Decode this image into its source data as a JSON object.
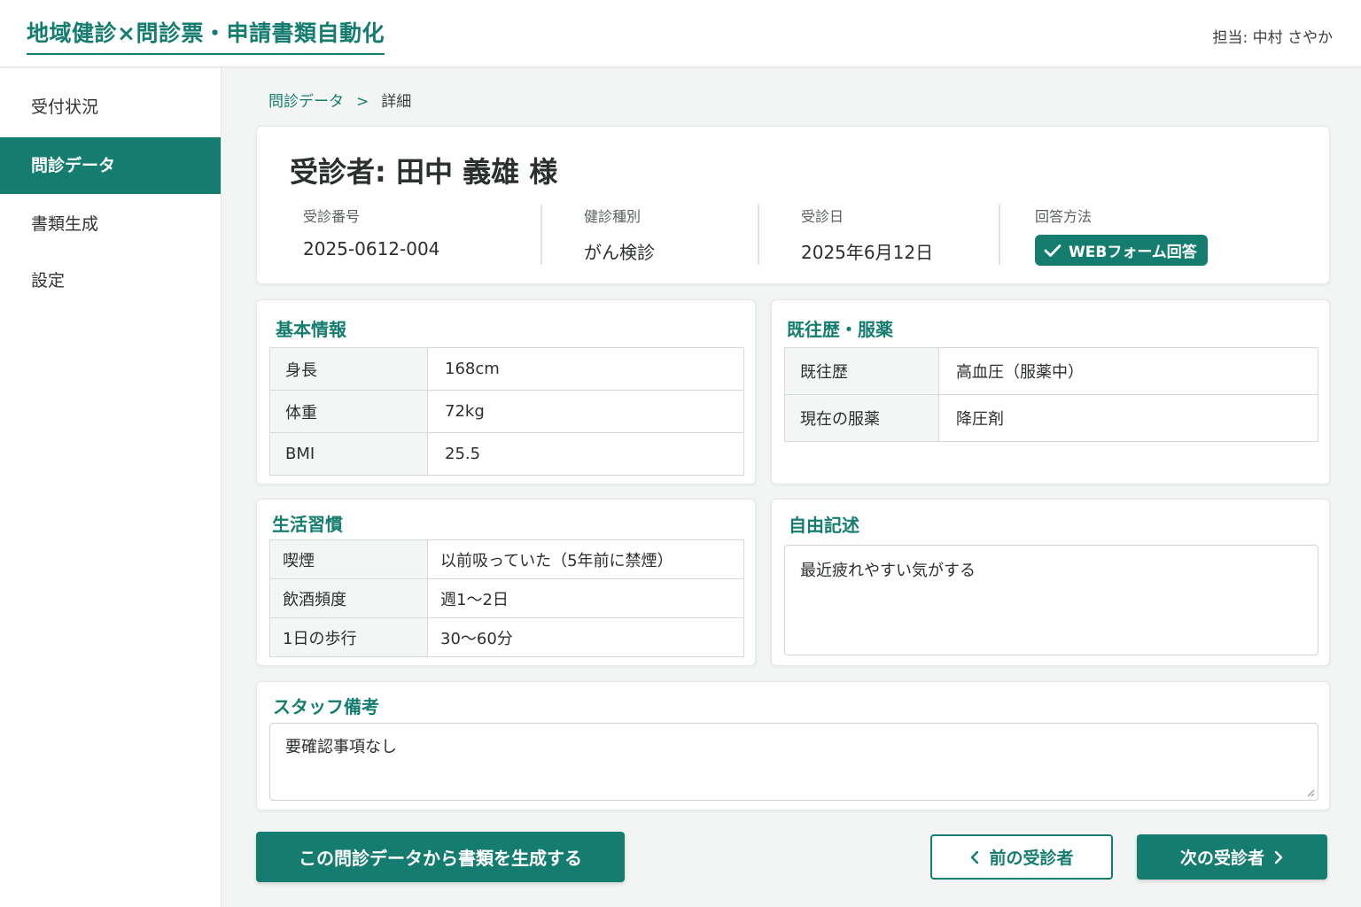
{
  "header": {
    "app_title": "地域健診×問診票・申請書類自動化",
    "user_label": "担当: 中村 さやか"
  },
  "sidebar": {
    "items": [
      {
        "label": "受付状況"
      },
      {
        "label": "問診データ",
        "active": true
      },
      {
        "label": "書類生成"
      },
      {
        "label": "設定"
      }
    ]
  },
  "breadcrumb": {
    "parent": "問診データ",
    "separator": ">",
    "current": "詳細"
  },
  "patient": {
    "title": "受診者: 田中 義雄 様",
    "exam_number_label": "受診番号",
    "exam_number": "2025-0612-004",
    "exam_type_label": "健診種別",
    "exam_type": "がん検診",
    "exam_date_label": "受診日",
    "exam_date": "2025年6月12日",
    "answer_method_label": "回答方法",
    "answer_method": "WEBフォーム回答"
  },
  "basic_info": {
    "title": "基本情報",
    "rows": [
      {
        "key": "身長",
        "value": "168cm"
      },
      {
        "key": "体重",
        "value": "72kg"
      },
      {
        "key": "BMI",
        "value": "25.5"
      }
    ]
  },
  "history": {
    "title": "既往歴・服薬",
    "rows": [
      {
        "key": "既往歴",
        "value": "高血圧（服薬中）"
      },
      {
        "key": "現在の服薬",
        "value": "降圧剤"
      }
    ]
  },
  "lifestyle": {
    "title": "生活習慣",
    "rows": [
      {
        "key": "喫煙",
        "value": "以前吸っていた（5年前に禁煙）"
      },
      {
        "key": "飲酒頻度",
        "value": "週1〜2日"
      },
      {
        "key": "1日の歩行",
        "value": "30〜60分"
      }
    ]
  },
  "free_text": {
    "title": "自由記述",
    "content": "最近疲れやすい気がする"
  },
  "staff_notes": {
    "title": "スタッフ備考",
    "content": "要確認事項なし"
  },
  "actions": {
    "generate_label": "この問診データから書類を生成する",
    "prev_label": "前の受診者",
    "next_label": "次の受診者"
  },
  "colors": {
    "primary": "#147d6f",
    "background": "#f3f5f4"
  }
}
